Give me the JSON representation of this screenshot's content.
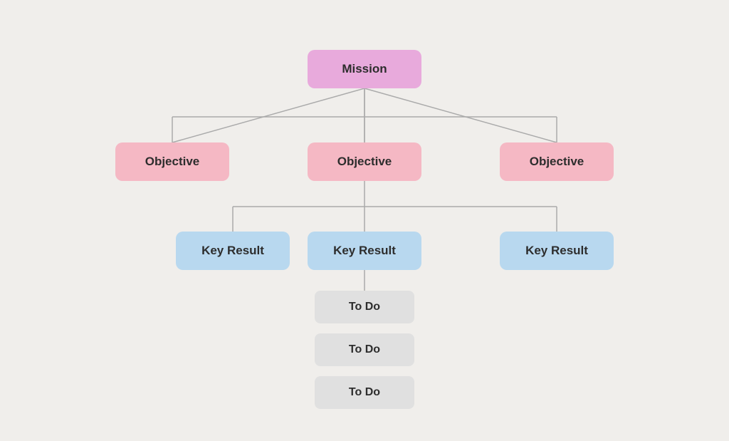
{
  "nodes": {
    "mission": {
      "label": "Mission"
    },
    "objectives": [
      {
        "label": "Objective"
      },
      {
        "label": "Objective"
      },
      {
        "label": "Objective"
      }
    ],
    "keyResults": [
      {
        "label": "Key Result"
      },
      {
        "label": "Key Result"
      },
      {
        "label": "Key Result"
      }
    ],
    "todos": [
      {
        "label": "To Do"
      },
      {
        "label": "To Do"
      },
      {
        "label": "To Do"
      }
    ]
  }
}
